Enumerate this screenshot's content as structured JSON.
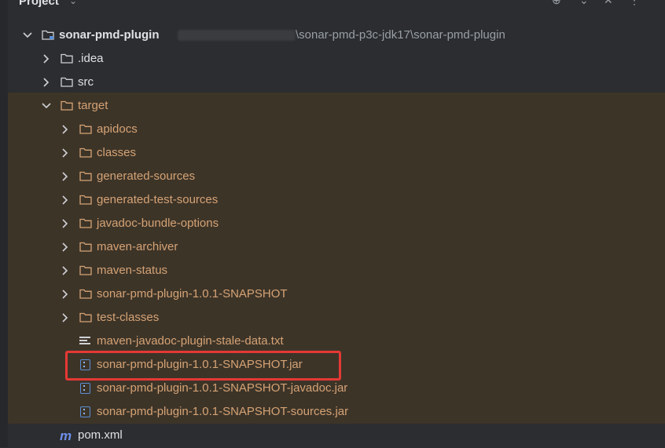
{
  "panel": {
    "title": "Project"
  },
  "tree": {
    "root": {
      "name": "sonar-pmd-plugin",
      "path": "\\sonar-pmd-p3c-jdk17\\sonar-pmd-plugin"
    },
    "idea": ".idea",
    "src": "src",
    "target": "target",
    "target_children": [
      "apidocs",
      "classes",
      "generated-sources",
      "generated-test-sources",
      "javadoc-bundle-options",
      "maven-archiver",
      "maven-status",
      "sonar-pmd-plugin-1.0.1-SNAPSHOT",
      "test-classes"
    ],
    "stale_txt": "maven-javadoc-plugin-stale-data.txt",
    "jar_main": "sonar-pmd-plugin-1.0.1-SNAPSHOT.jar",
    "jar_javadoc": "sonar-pmd-plugin-1.0.1-SNAPSHOT-javadoc.jar",
    "jar_sources": "sonar-pmd-plugin-1.0.1-SNAPSHOT-sources.jar",
    "pom": "pom.xml",
    "pom_icon_glyph": "m"
  },
  "colors": {
    "excluded_bg": "#3d3428",
    "excluded_text": "#d5a375",
    "highlight": "#e53935"
  }
}
